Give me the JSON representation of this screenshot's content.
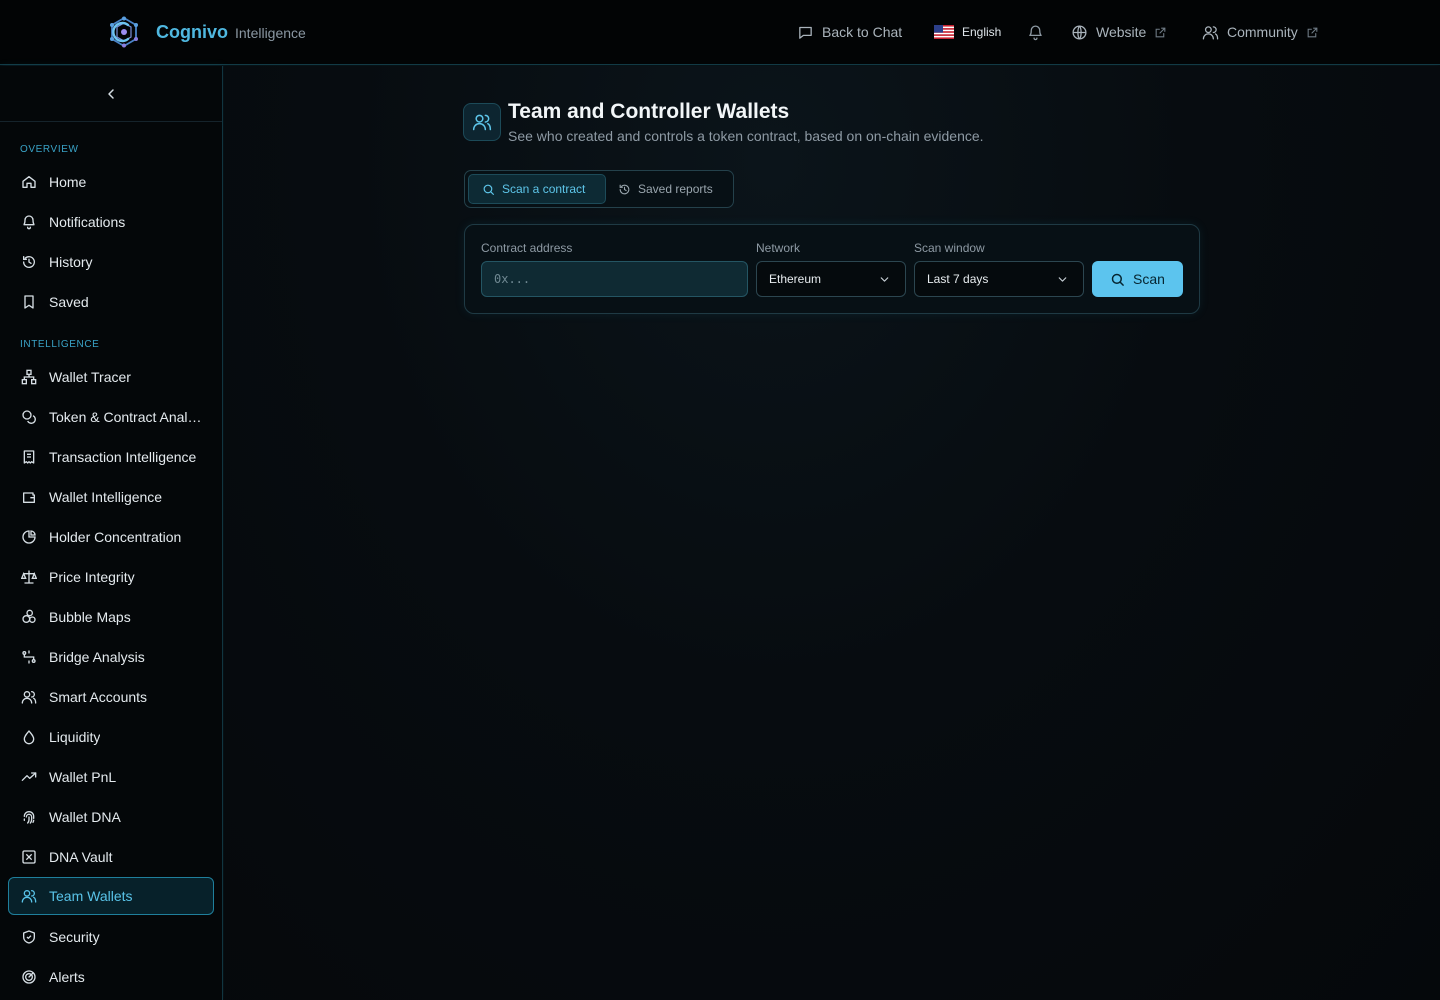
{
  "header": {
    "brand_name": "Cognivo",
    "brand_sub": "Intelligence",
    "back_to_chat": "Back to Chat",
    "language": "English",
    "website": "Website",
    "community": "Community"
  },
  "sidebar": {
    "overview_label": "OVERVIEW",
    "intelligence_label": "INTELLIGENCE",
    "overview_items": [
      {
        "label": "Home",
        "icon": "home-icon"
      },
      {
        "label": "Notifications",
        "icon": "bell-icon"
      },
      {
        "label": "History",
        "icon": "history-icon"
      },
      {
        "label": "Saved",
        "icon": "bookmark-icon"
      }
    ],
    "intelligence_items": [
      {
        "label": "Wallet Tracer",
        "icon": "network-icon"
      },
      {
        "label": "Token & Contract Analysis",
        "icon": "coins-icon"
      },
      {
        "label": "Transaction Intelligence",
        "icon": "receipt-icon"
      },
      {
        "label": "Wallet Intelligence",
        "icon": "wallet-icon"
      },
      {
        "label": "Holder Concentration",
        "icon": "pie-chart-icon"
      },
      {
        "label": "Price Integrity",
        "icon": "scale-icon"
      },
      {
        "label": "Bubble Maps",
        "icon": "bubbles-icon"
      },
      {
        "label": "Bridge Analysis",
        "icon": "bridge-icon"
      },
      {
        "label": "Smart Accounts",
        "icon": "users-icon"
      },
      {
        "label": "Liquidity",
        "icon": "droplet-icon"
      },
      {
        "label": "Wallet PnL",
        "icon": "trending-up-icon"
      },
      {
        "label": "Wallet DNA",
        "icon": "fingerprint-icon"
      },
      {
        "label": "DNA Vault",
        "icon": "vault-icon"
      },
      {
        "label": "Team Wallets",
        "icon": "users-icon",
        "active": true
      },
      {
        "label": "Security",
        "icon": "shield-icon"
      },
      {
        "label": "Alerts",
        "icon": "radar-icon"
      }
    ]
  },
  "page": {
    "title": "Team and Controller Wallets",
    "subtitle": "See who created and controls a token contract, based on on-chain evidence."
  },
  "tabs": {
    "scan": "Scan a contract",
    "saved": "Saved reports"
  },
  "form": {
    "address_label": "Contract address",
    "address_placeholder": "0x...",
    "address_value": "",
    "network_label": "Network",
    "network_value": "Ethereum",
    "window_label": "Scan window",
    "window_value": "Last 7 days",
    "scan_button": "Scan"
  },
  "colors": {
    "accent": "#5cc4ee",
    "brand": "#4fb8e0",
    "background": "#05080b"
  }
}
